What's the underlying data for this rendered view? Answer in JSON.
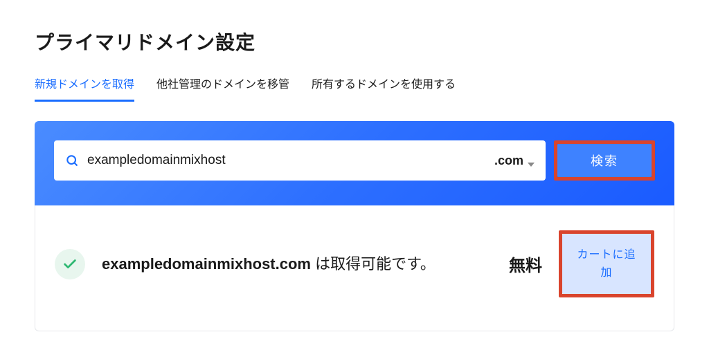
{
  "page_title": "プライマリドメイン設定",
  "tabs": [
    {
      "label": "新規ドメインを取得",
      "active": true
    },
    {
      "label": "他社管理のドメインを移管",
      "active": false
    },
    {
      "label": "所有するドメインを使用する",
      "active": false
    }
  ],
  "search": {
    "value": "exampledomainmixhost",
    "tld": ".com",
    "button_label": "検索"
  },
  "result": {
    "domain": "exampledomainmixhost.com",
    "suffix_text": " は取得可能です。",
    "price": "無料",
    "cart_button_label": "カートに追加"
  }
}
